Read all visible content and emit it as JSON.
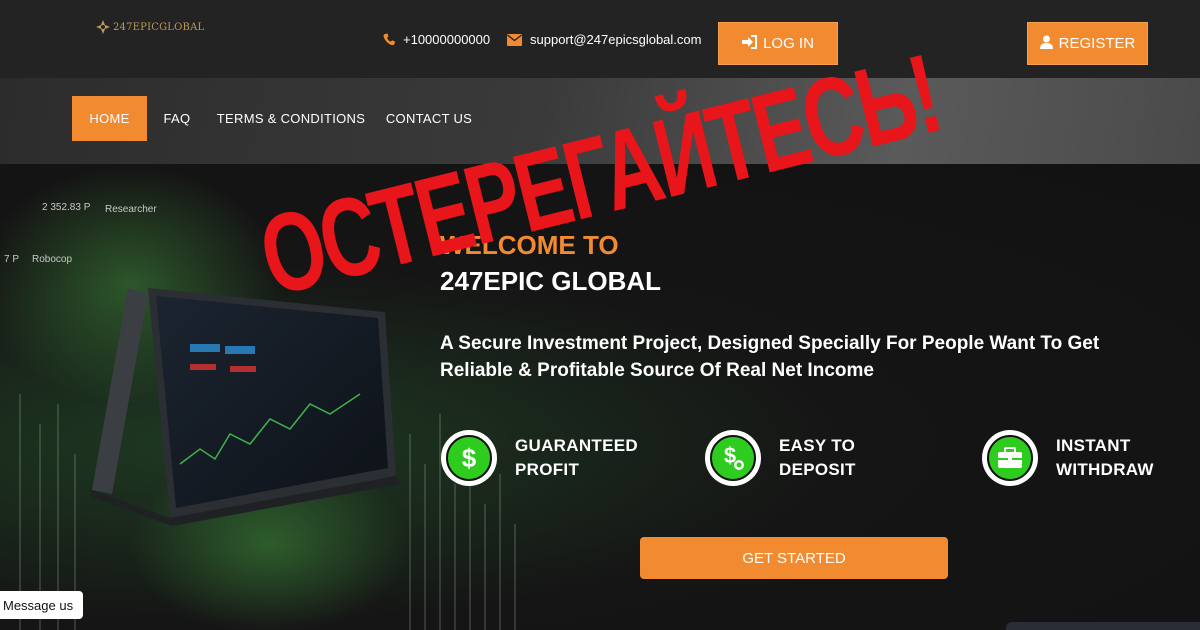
{
  "header": {
    "logo_text": "247EPICGLOBAL",
    "phone": "+10000000000",
    "email": "support@247epicsglobal.com",
    "login_label": "LOG IN",
    "register_label": "REGISTER"
  },
  "nav": {
    "items": [
      {
        "label": "HOME",
        "active": true
      },
      {
        "label": "FAQ"
      },
      {
        "label": "TERMS & CONDITIONS"
      },
      {
        "label": "CONTACT US"
      }
    ]
  },
  "hero": {
    "tickers": [
      "2 352.83 P",
      "Researcher",
      "7 P",
      "Robocop"
    ],
    "welcome": "WELCOME TO",
    "brand": "247EPIC GLOBAL",
    "tagline": "A Secure Investment Project, Designed Specially For People Want To Get Reliable & Profitable Source Of Real Net Income",
    "features": [
      {
        "line1": "GUARANTEED",
        "line2": "PROFIT",
        "icon": "dollar-icon"
      },
      {
        "line1": "EASY TO",
        "line2": "DEPOSIT",
        "icon": "money-bag-icon"
      },
      {
        "line1": "INSTANT",
        "line2": "WITHDRAW",
        "icon": "briefcase-icon"
      }
    ],
    "cta_label": "GET STARTED"
  },
  "chat": {
    "label": "Message us"
  },
  "overlay": {
    "warning_text": "ОСТЕРЕГАЙТЕСЬ!"
  },
  "colors": {
    "accent": "#f28b30",
    "warning": "#e8151b",
    "feature_icon": "#2ecc1f"
  }
}
